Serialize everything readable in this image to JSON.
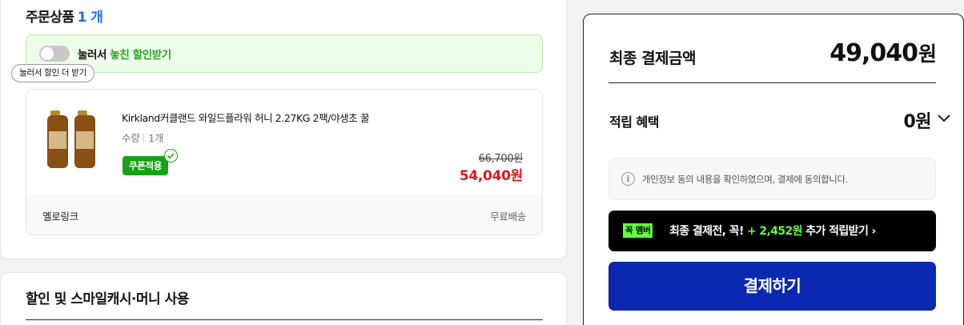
{
  "order_section": {
    "title": "주문상품",
    "count": "1 개"
  },
  "promo": {
    "prefix": "눌러서",
    "highlight": "놓친 할인받기",
    "tooltip": "눌러서 할인 더 받기"
  },
  "item": {
    "name": "Kirkland커클랜드 와일드플라워 허니 2.27KG 2팩/야생초 꿀",
    "qty_label": "수량",
    "qty_value": "1개",
    "coupon_badge": "쿠폰적용",
    "original_price": "66,700원",
    "sale_price": "54,040원",
    "seller": "옐로링크",
    "shipping": "무료배송"
  },
  "discount_section": {
    "title": "할인 및 스마일캐시·머니 사용"
  },
  "summary": {
    "total_label": "최종 결제금액",
    "total_amount": "49,040",
    "total_unit": "원",
    "reward_label": "적립 혜택",
    "reward_value": "0원",
    "notice": "개인정보 동의 내용을 확인하였으며, 결제에 동의합니다.",
    "member_badge": "꼭 멤버",
    "member_text_pre": "최종 결제전, 꼭!",
    "member_text_amount": "+ 2,452원",
    "member_text_post": "추가 적립받기 ›",
    "pay_button": "결제하기"
  },
  "colors": {
    "accent_blue": "#1f6fe5",
    "sale_red": "#e0161b",
    "coupon_green": "#16a317",
    "member_green": "#5eff3c",
    "pay_button_bg": "#0b28b0"
  }
}
